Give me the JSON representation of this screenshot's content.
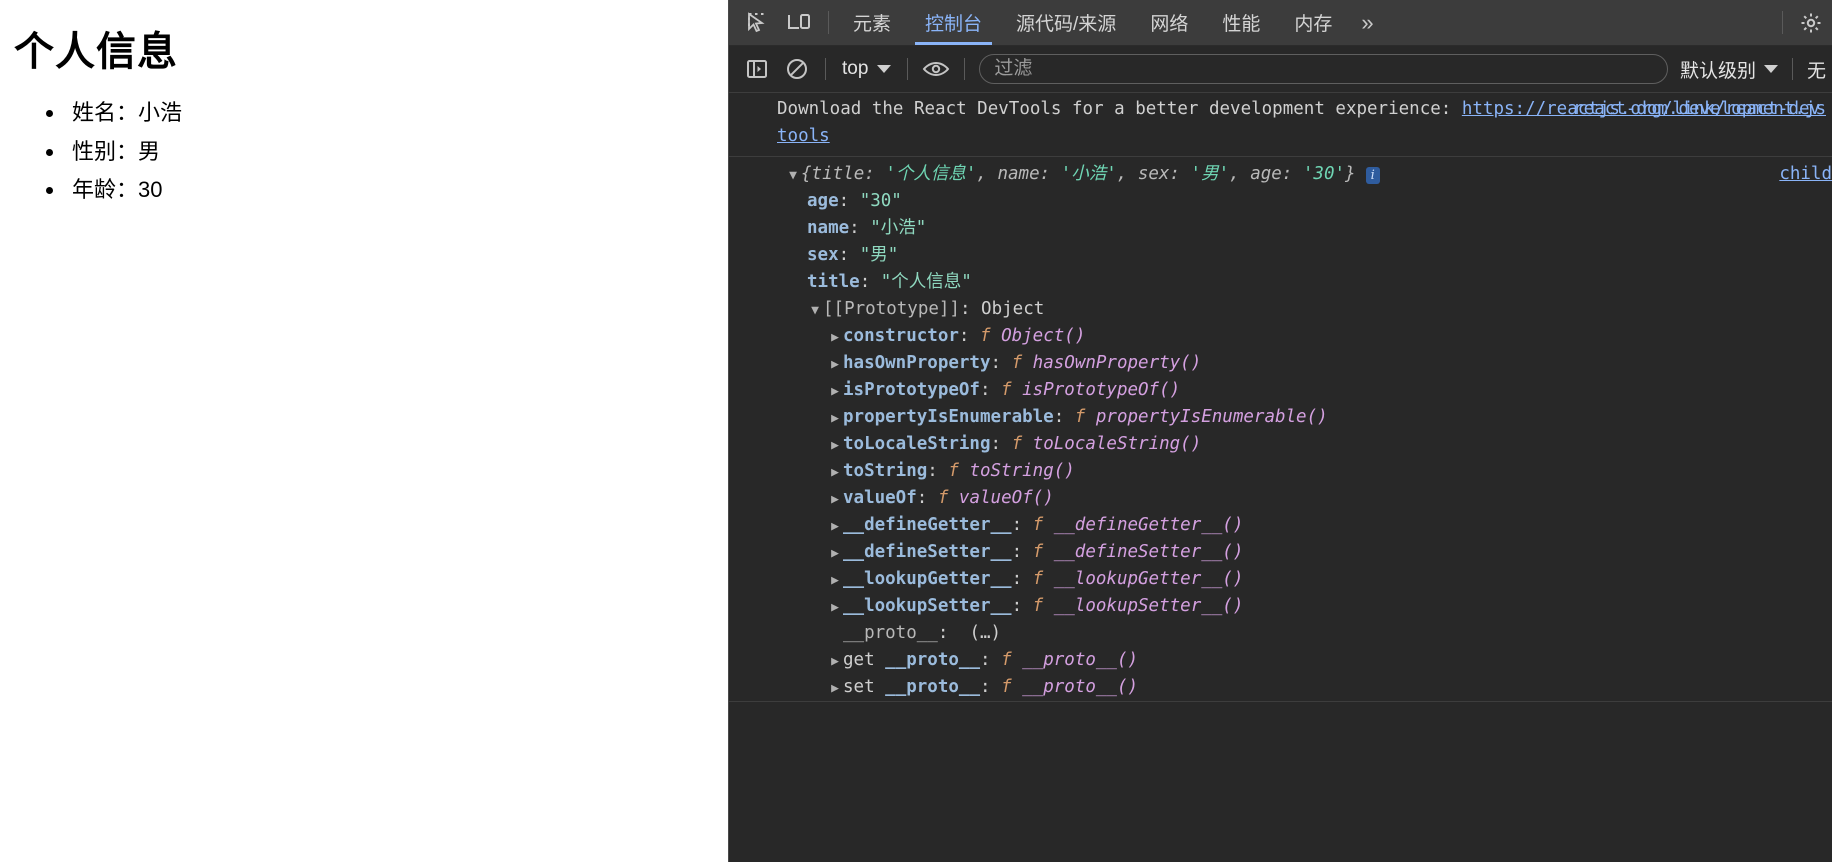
{
  "page": {
    "title": "个人信息",
    "items": [
      "姓名：小浩",
      "性别：男",
      "年龄：30"
    ]
  },
  "devtools": {
    "icons": {
      "inspect": "inspect-element-icon",
      "device": "device-toolbar-icon",
      "sidebar": "console-sidebar-icon",
      "clear": "clear-console-icon",
      "eye": "live-expression-eye-icon",
      "settings": "gear-icon"
    },
    "tabs": [
      {
        "label": "元素",
        "active": false
      },
      {
        "label": "控制台",
        "active": true
      },
      {
        "label": "源代码/来源",
        "active": false
      },
      {
        "label": "网络",
        "active": false
      },
      {
        "label": "性能",
        "active": false
      },
      {
        "label": "内存",
        "active": false
      }
    ],
    "more_tabs_label": "»",
    "toolbar": {
      "context_label": "top",
      "filter_placeholder": "过滤",
      "filter_value": "",
      "levels_label": "默认级别",
      "issues_label": "无"
    },
    "console": {
      "react_message": {
        "source": "react-dom.development.js",
        "text_before": "Download the React DevTools for a better development experience: ",
        "link": "https://reactjs.org/link/react-devtools"
      },
      "object": {
        "preview": {
          "open": "{",
          "entries": [
            {
              "key": "title",
              "value": "'个人信息'"
            },
            {
              "key": "name",
              "value": "'小浩'"
            },
            {
              "key": "sex",
              "value": "'男'"
            },
            {
              "key": "age",
              "value": "'30'"
            }
          ],
          "close": "}",
          "info_badge": "i",
          "source_link": "child"
        },
        "own_properties": [
          {
            "key": "age",
            "value": "\"30\""
          },
          {
            "key": "name",
            "value": "\"小浩\""
          },
          {
            "key": "sex",
            "value": "\"男\""
          },
          {
            "key": "title",
            "value": "\"个人信息\""
          }
        ],
        "prototype_label": "[[Prototype]]",
        "prototype_value": "Object",
        "prototype_members": [
          {
            "key": "constructor",
            "fn": "Object()"
          },
          {
            "key": "hasOwnProperty",
            "fn": "hasOwnProperty()"
          },
          {
            "key": "isPrototypeOf",
            "fn": "isPrototypeOf()"
          },
          {
            "key": "propertyIsEnumerable",
            "fn": "propertyIsEnumerable()"
          },
          {
            "key": "toLocaleString",
            "fn": "toLocaleString()"
          },
          {
            "key": "toString",
            "fn": "toString()"
          },
          {
            "key": "valueOf",
            "fn": "valueOf()"
          },
          {
            "key": "__defineGetter__",
            "fn": "__defineGetter__()"
          },
          {
            "key": "__defineSetter__",
            "fn": "__defineSetter__()"
          },
          {
            "key": "__lookupGetter__",
            "fn": "__lookupGetter__()"
          },
          {
            "key": "__lookupSetter__",
            "fn": "__lookupSetter__()"
          }
        ],
        "proto_plain": {
          "key": "__proto__",
          "value": "(…)"
        },
        "accessors": [
          {
            "kind": "get",
            "key": "__proto__",
            "fn": "__proto__()"
          },
          {
            "kind": "set",
            "key": "__proto__",
            "fn": "__proto__()"
          }
        ]
      }
    }
  },
  "colors": {
    "accent": "#8ab4f8",
    "string": "#8fd9c0",
    "property": "#9bbbdc",
    "function": "#d4a0e0",
    "panel_bg": "#282828",
    "tabbar_bg": "#3c3c3c"
  }
}
